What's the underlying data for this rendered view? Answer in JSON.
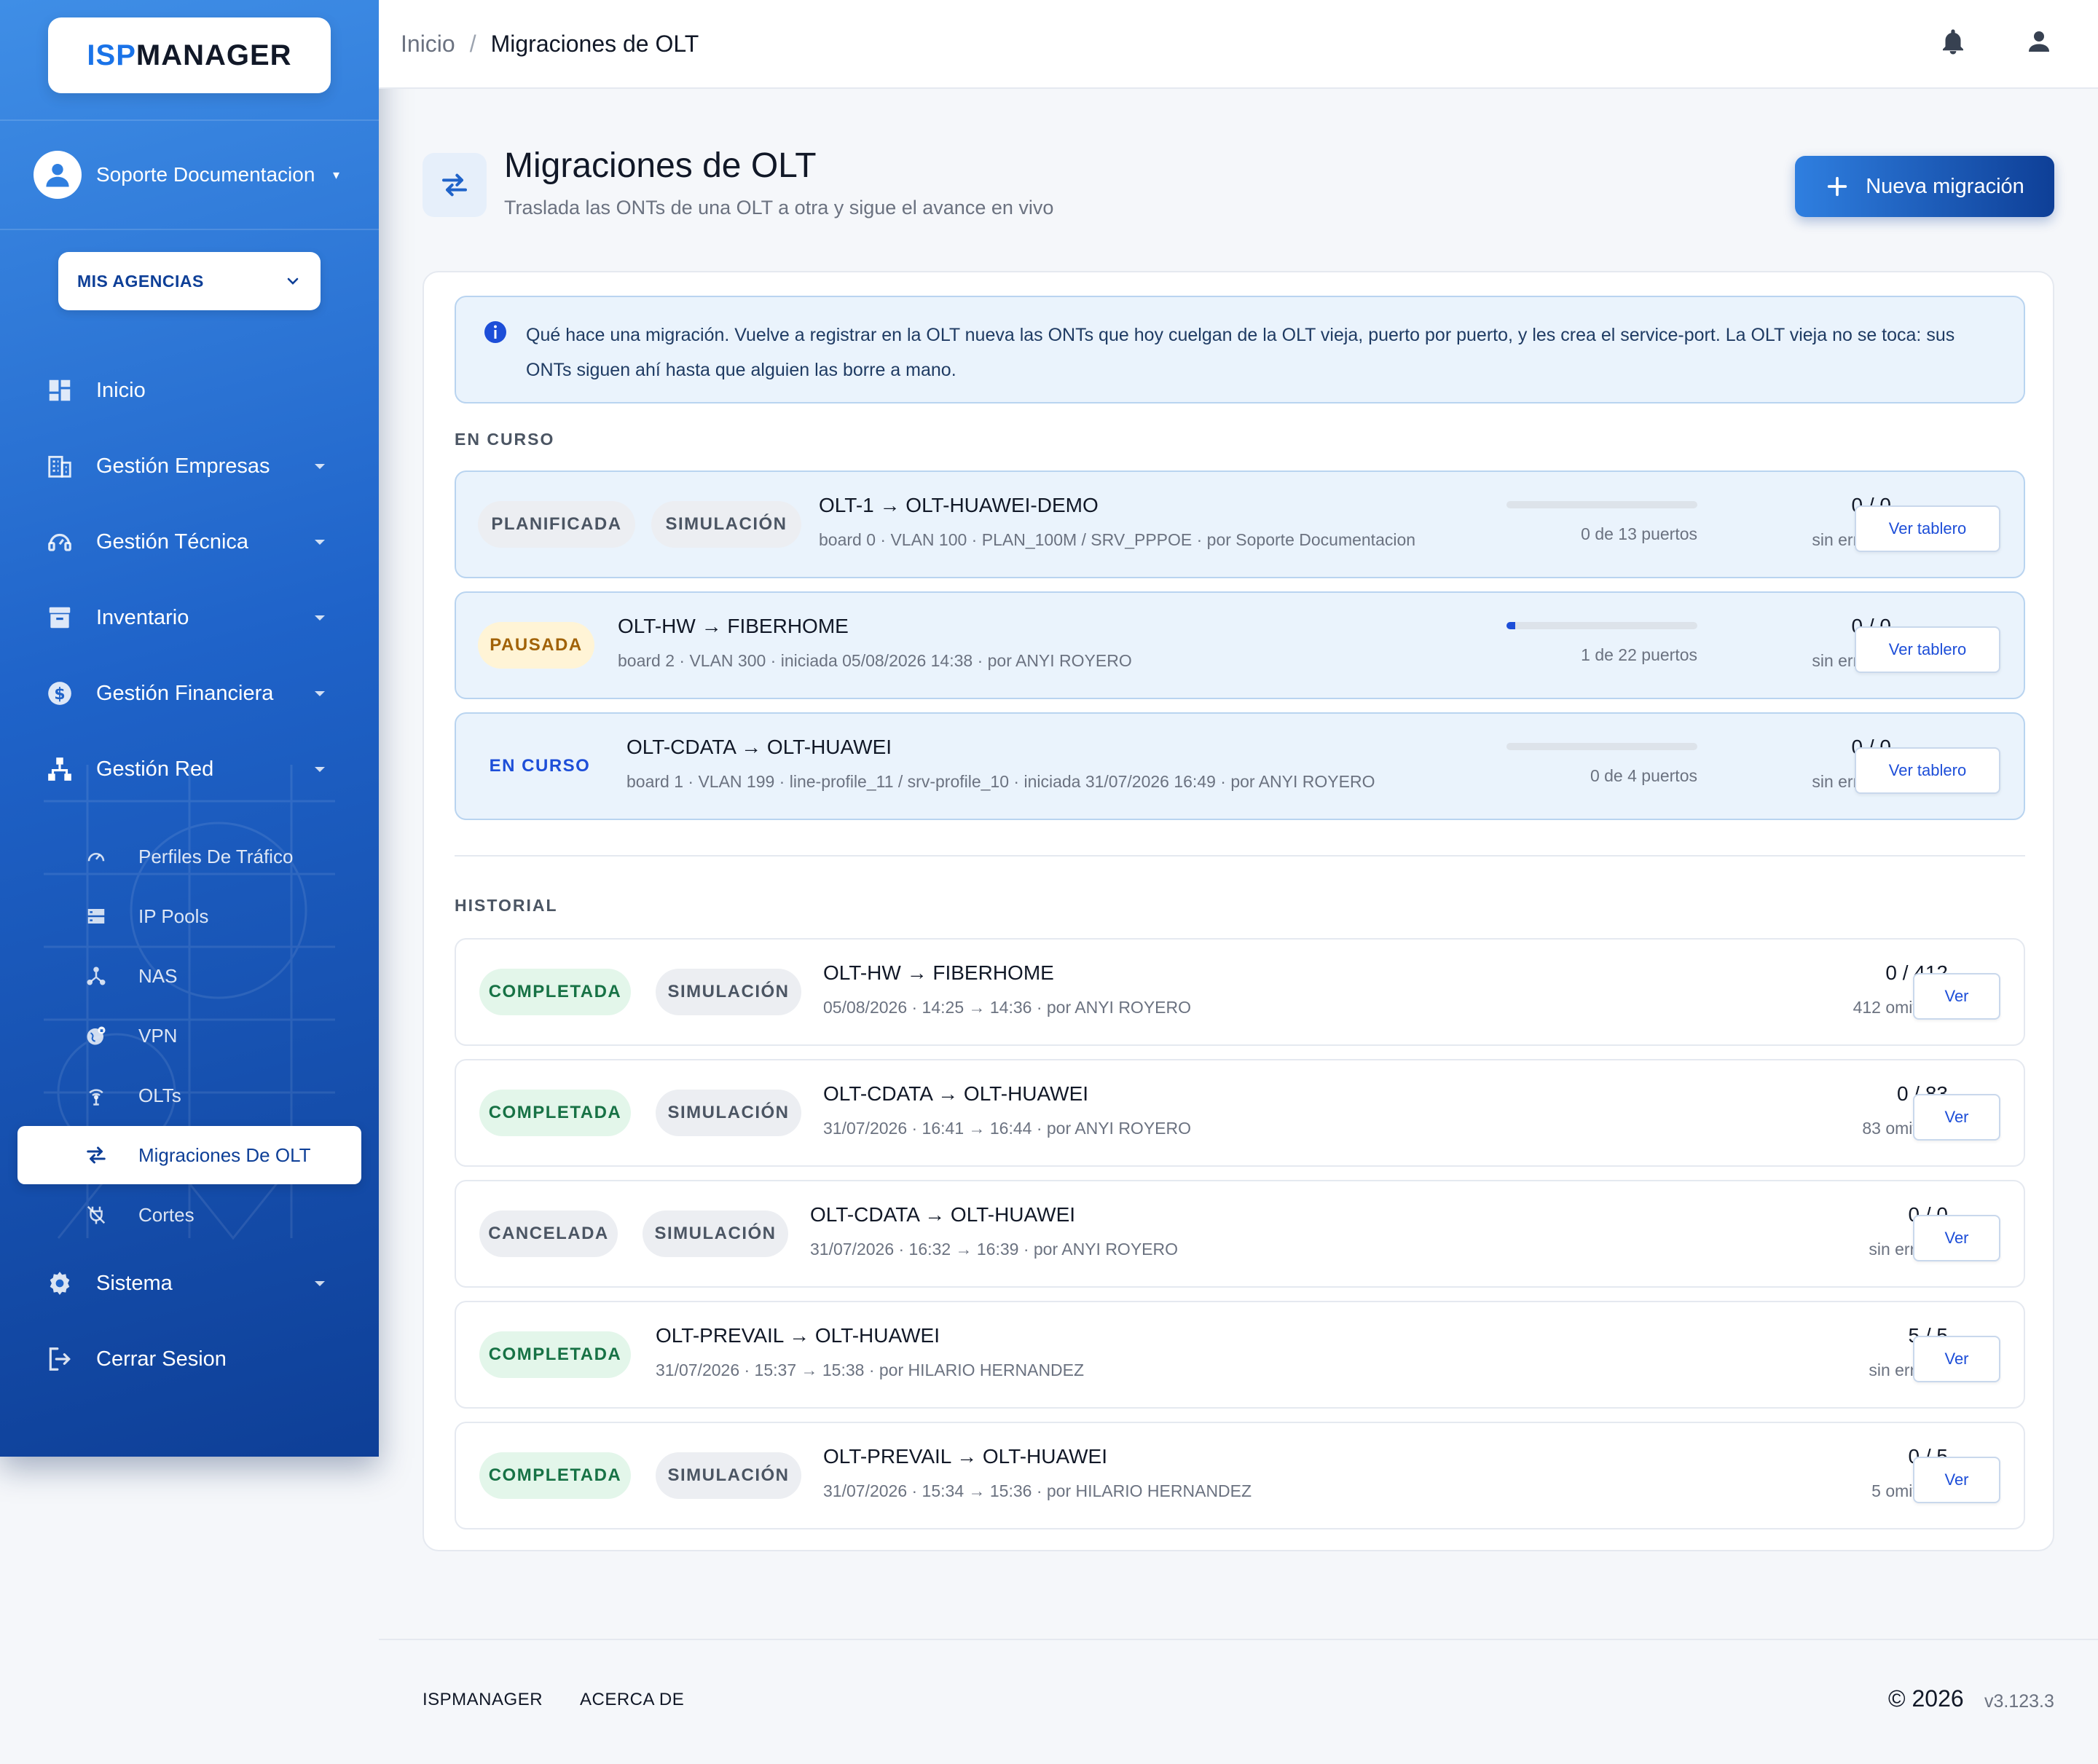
{
  "app": {
    "logo_isp": "ISP",
    "logo_manager": "MANAGER"
  },
  "sidebar": {
    "user_name": "Soporte Documentacion",
    "agency_label": "MIS AGENCIAS",
    "items": [
      {
        "label": "Inicio",
        "icon": "dashboard-icon"
      },
      {
        "label": "Gestión Empresas",
        "icon": "building-icon"
      },
      {
        "label": "Gestión Técnica",
        "icon": "support-icon"
      },
      {
        "label": "Inventario",
        "icon": "archive-icon"
      },
      {
        "label": "Gestión Financiera",
        "icon": "dollar-icon"
      },
      {
        "label": "Gestión Red",
        "icon": "network-icon"
      },
      {
        "label": "Sistema",
        "icon": "gear-icon"
      },
      {
        "label": "Cerrar Sesion",
        "icon": "logout-icon"
      }
    ],
    "sub_items": [
      {
        "label": "Perfiles De Tráfico",
        "icon": "speedometer-icon"
      },
      {
        "label": "IP Pools",
        "icon": "server-icon"
      },
      {
        "label": "NAS",
        "icon": "hub-icon"
      },
      {
        "label": "VPN",
        "icon": "vpn-globe-icon"
      },
      {
        "label": "OLTs",
        "icon": "antenna-icon"
      },
      {
        "label": "Migraciones De OLT",
        "icon": "swap-icon"
      },
      {
        "label": "Cortes",
        "icon": "plug-off-icon"
      }
    ]
  },
  "topbar": {
    "crumb_home": "Inicio",
    "crumb_sep": "/",
    "crumb_current": "Migraciones de OLT"
  },
  "header": {
    "title": "Migraciones de OLT",
    "subtitle": "Traslada las ONTs de una OLT a otra y sigue el avance en vivo",
    "new_button": "Nueva migración"
  },
  "info": {
    "text": "Qué hace una migración. Vuelve a registrar en la OLT nueva las ONTs que hoy cuelgan de la OLT vieja, puerto por puerto, y les crea el service-port. La OLT vieja no se toca: sus ONTs siguen ahí hasta que alguien las borre a mano."
  },
  "sections": {
    "in_progress": "EN CURSO",
    "history": "HISTORIAL"
  },
  "in_progress": [
    {
      "status": "PLANIFICADA",
      "mode": "SIMULACIÓN",
      "title": "OLT-1 → OLT-HUAWEI-DEMO",
      "meta": "board 0 · VLAN 100 · PLAN_100M / SRV_PPPOE · por Soporte Documentacion",
      "progress_text": "0 de 13 puertos",
      "progress": 0,
      "count": "0 / 0",
      "count_sub": "sin errores",
      "button": "Ver tablero"
    },
    {
      "status": "PAUSADA",
      "mode": "",
      "title": "OLT-HW → FIBERHOME",
      "meta": "board 2 · VLAN 300 · iniciada 05/08/2026 14:38 · por ANYI ROYERO",
      "progress_text": "1 de 22 puertos",
      "progress": 0.045,
      "count": "0 / 0",
      "count_sub": "sin errores",
      "button": "Ver tablero"
    },
    {
      "status": "EN CURSO",
      "mode": "",
      "title": "OLT-CDATA → OLT-HUAWEI",
      "meta": "board 1 · VLAN 199 · line-profile_11 / srv-profile_10 · iniciada 31/07/2026 16:49 · por ANYI ROYERO",
      "progress_text": "0 de 4 puertos",
      "progress": 0,
      "count": "0 / 0",
      "count_sub": "sin errores",
      "button": "Ver tablero"
    }
  ],
  "history": [
    {
      "status": "COMPLETADA",
      "mode": "SIMULACIÓN",
      "title": "OLT-HW → FIBERHOME",
      "meta": "05/08/2026 · 14:25 → 14:36 · por ANYI ROYERO",
      "count": "0 / 412",
      "count_sub": "412 omitidas",
      "button": "Ver"
    },
    {
      "status": "COMPLETADA",
      "mode": "SIMULACIÓN",
      "title": "OLT-CDATA → OLT-HUAWEI",
      "meta": "31/07/2026 · 16:41 → 16:44 · por ANYI ROYERO",
      "count": "0 / 83",
      "count_sub": "83 omitidas",
      "button": "Ver"
    },
    {
      "status": "CANCELADA",
      "mode": "SIMULACIÓN",
      "title": "OLT-CDATA → OLT-HUAWEI",
      "meta": "31/07/2026 · 16:32 → 16:39 · por ANYI ROYERO",
      "count": "0 / 0",
      "count_sub": "sin errores",
      "button": "Ver"
    },
    {
      "status": "COMPLETADA",
      "mode": "",
      "title": "OLT-PREVAIL → OLT-HUAWEI",
      "meta": "31/07/2026 · 15:37 → 15:38 · por HILARIO HERNANDEZ",
      "count": "5 / 5",
      "count_sub": "sin errores",
      "button": "Ver"
    },
    {
      "status": "COMPLETADA",
      "mode": "SIMULACIÓN",
      "title": "OLT-PREVAIL → OLT-HUAWEI",
      "meta": "31/07/2026 · 15:34 → 15:36 · por HILARIO HERNANDEZ",
      "count": "0 / 5",
      "count_sub": "5 omitidas",
      "button": "Ver"
    }
  ],
  "footer": {
    "link1": "ISPMANAGER",
    "link2": "ACERCA DE",
    "copyright": "© 2026",
    "version": "v3.123.3"
  },
  "colors": {
    "primary": "#1d4ed8",
    "sidebar_top": "#3f8ee6",
    "sidebar_bottom": "#0e3f97",
    "success": "#177245",
    "warning": "#a16207"
  }
}
